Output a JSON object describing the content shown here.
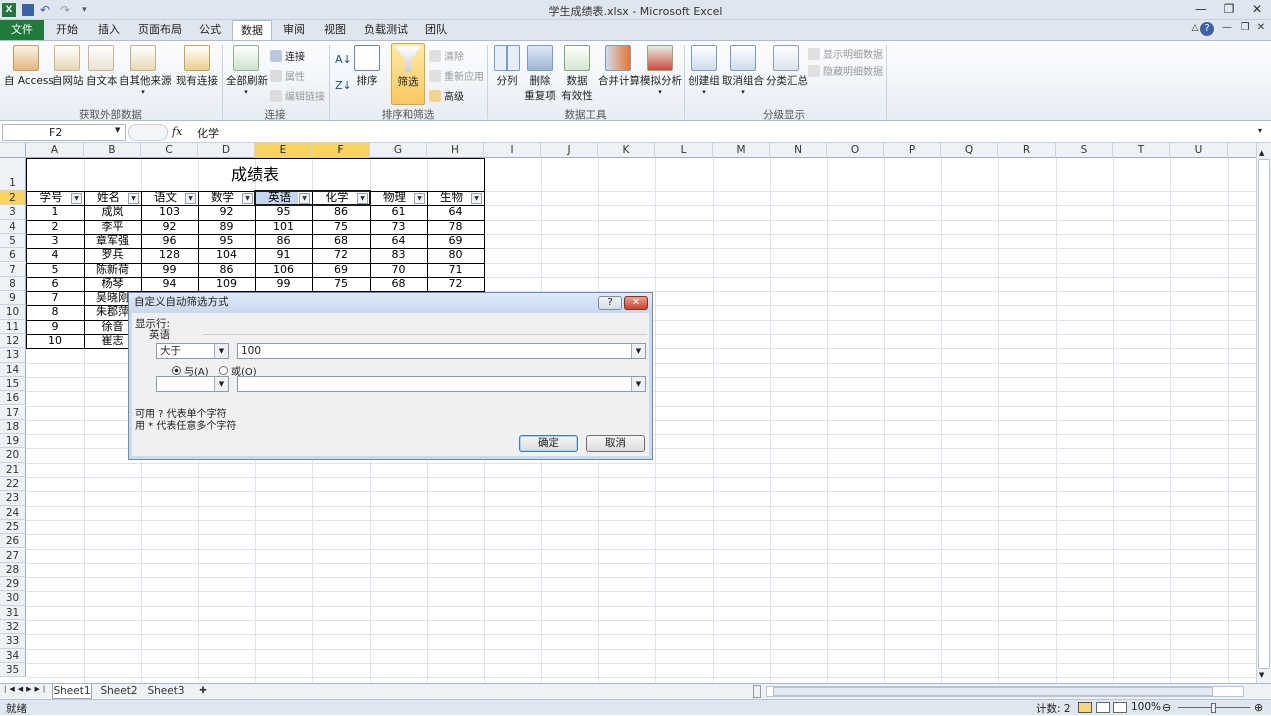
{
  "titlebar": {
    "title": "学生成绩表.xlsx - Microsoft Excel"
  },
  "tabs": {
    "file": "文件",
    "home": "开始",
    "insert": "插入",
    "layout": "页面布局",
    "formulas": "公式",
    "data": "数据",
    "review": "审阅",
    "view": "视图",
    "loadtest": "负载测试",
    "team": "团队"
  },
  "ribbon": {
    "access": "自 Access",
    "web": "自网站",
    "text": "自文本",
    "other": "自其他来源",
    "existing": "现有连接",
    "group_external": "获取外部数据",
    "refresh_all": "全部刷新",
    "connections": "连接",
    "properties": "属性",
    "edit_links": "编辑链接",
    "group_conn": "连接",
    "sort": "排序",
    "filter": "筛选",
    "clear": "清除",
    "reapply": "重新应用",
    "advanced": "高级",
    "group_sort": "排序和筛选",
    "split": "分列",
    "remove_dup_1": "删除",
    "remove_dup_2": "重复项",
    "validation_1": "数据",
    "validation_2": "有效性",
    "consolidate": "合并计算",
    "whatif": "模拟分析",
    "group_tools": "数据工具",
    "group_btn": "创建组",
    "ungroup": "取消组合",
    "subtotal": "分类汇总",
    "show_detail": "显示明细数据",
    "hide_detail": "隐藏明细数据",
    "group_outline": "分级显示"
  },
  "formula": {
    "cell_ref": "F2",
    "fx": "fx",
    "content": "化学"
  },
  "columns": [
    "A",
    "B",
    "C",
    "D",
    "E",
    "F",
    "G",
    "H",
    "I",
    "J",
    "K",
    "L",
    "M",
    "N",
    "O",
    "P",
    "Q",
    "R",
    "S",
    "T",
    "U"
  ],
  "rows": [
    "1",
    "2",
    "3",
    "4",
    "5",
    "6",
    "7",
    "8",
    "9",
    "10",
    "11",
    "12",
    "13",
    "14",
    "15",
    "16",
    "17",
    "18",
    "19",
    "20",
    "21",
    "22",
    "23",
    "24",
    "25",
    "26",
    "27",
    "28",
    "29",
    "30",
    "31",
    "32",
    "33",
    "34",
    "35"
  ],
  "sheet": {
    "title": "成绩表",
    "headers": [
      "学号",
      "姓名",
      "语文",
      "数学",
      "英语",
      "化学",
      "物理",
      "生物"
    ],
    "data": [
      [
        "1",
        "成岚",
        "103",
        "92",
        "95",
        "86",
        "61",
        "64"
      ],
      [
        "2",
        "李平",
        "92",
        "89",
        "101",
        "75",
        "73",
        "78"
      ],
      [
        "3",
        "章军强",
        "96",
        "95",
        "86",
        "68",
        "64",
        "69"
      ],
      [
        "4",
        "罗兵",
        "128",
        "104",
        "91",
        "72",
        "83",
        "80"
      ],
      [
        "5",
        "陈新荷",
        "99",
        "86",
        "106",
        "69",
        "70",
        "71"
      ],
      [
        "6",
        "杨琴",
        "94",
        "109",
        "99",
        "75",
        "68",
        "72"
      ],
      [
        "7",
        "吴晓刚",
        "",
        "",
        "",
        "",
        "",
        ""
      ],
      [
        "8",
        "朱郡萍",
        "",
        "",
        "",
        "",
        "",
        ""
      ],
      [
        "9",
        "徐音",
        "",
        "",
        "",
        "",
        "",
        ""
      ],
      [
        "10",
        "崔志",
        "",
        "",
        "",
        "",
        "",
        ""
      ]
    ]
  },
  "dialog": {
    "title": "自定义自动筛选方式",
    "help": "?",
    "close": "✕",
    "show_rows": "显示行:",
    "field": "英语",
    "op1": "大于",
    "val1": "100",
    "and_label": "与(A)",
    "or_label": "或(O)",
    "op2": "",
    "val2": "",
    "hint1": "可用 ? 代表单个字符",
    "hint2": "用 * 代表任意多个字符",
    "ok": "确定",
    "cancel": "取消"
  },
  "sheettabs": [
    "Sheet1",
    "Sheet2",
    "Sheet3"
  ],
  "status": {
    "ready": "就绪",
    "count": "计数: 2",
    "zoom": "100%"
  }
}
